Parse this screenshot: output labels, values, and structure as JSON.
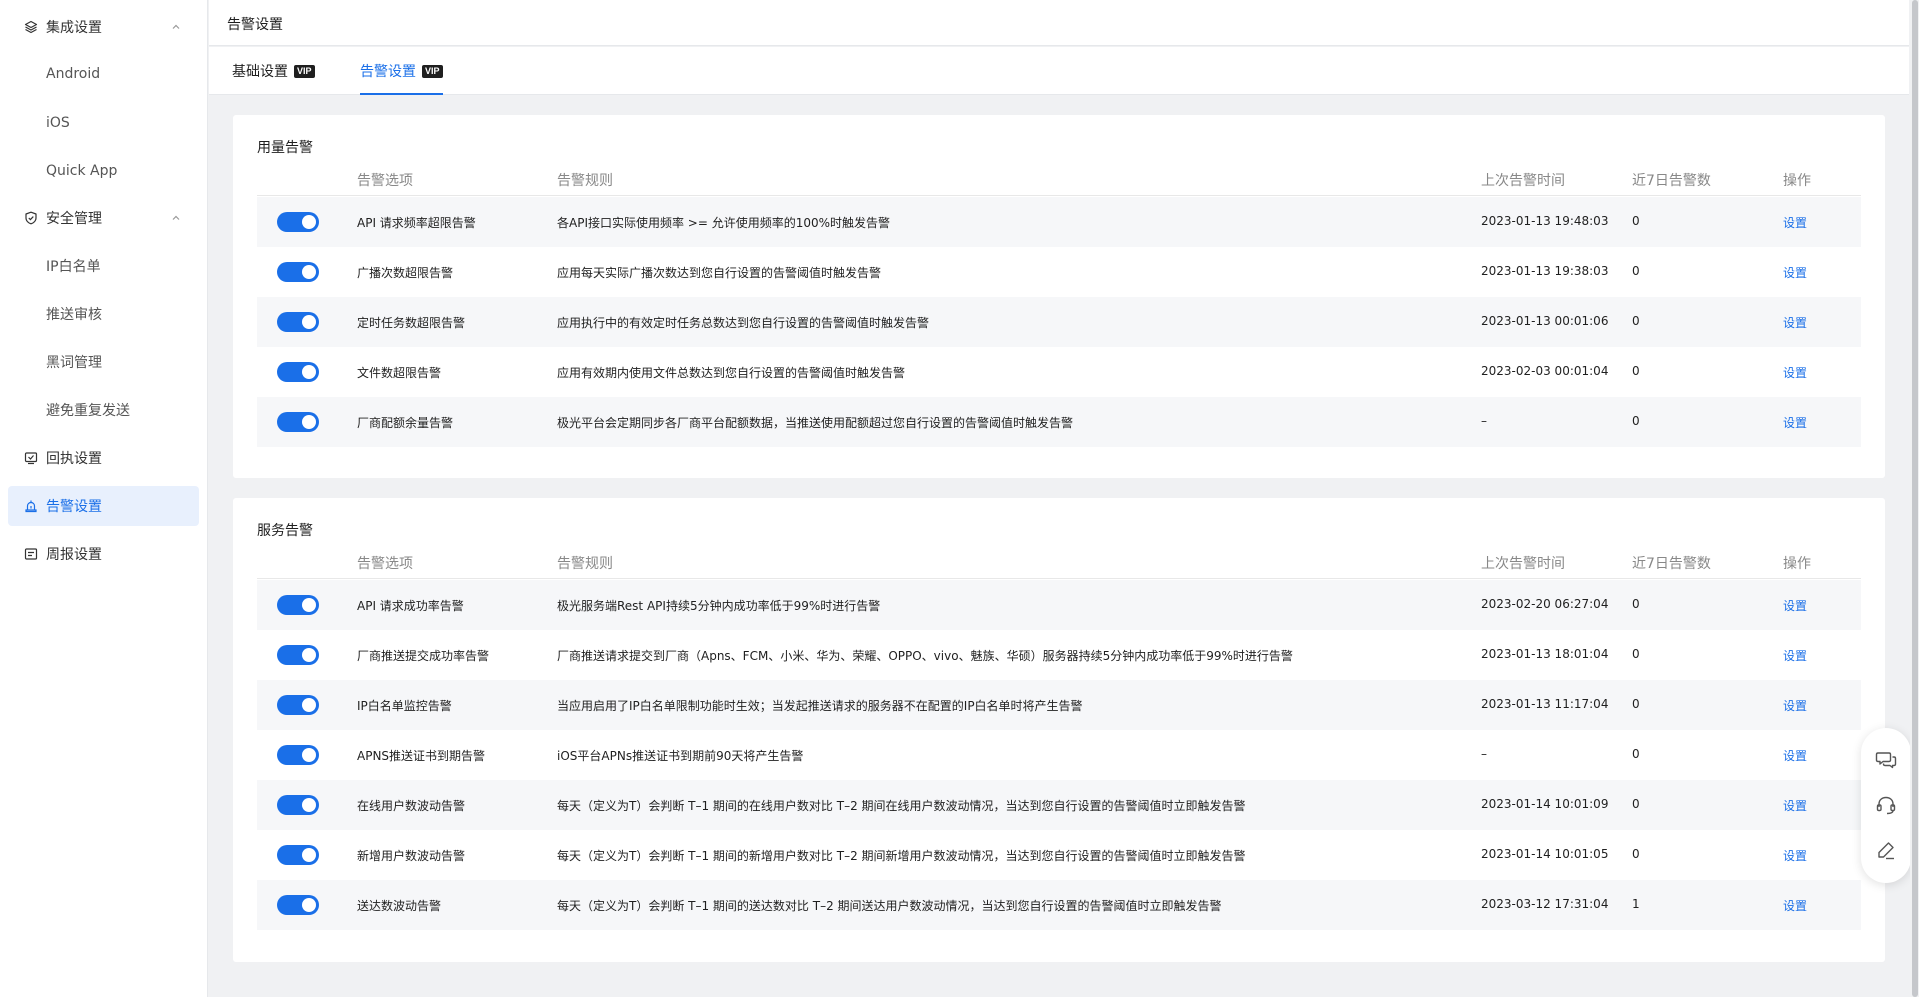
{
  "sidebar": {
    "groups": [
      {
        "label": "集成设置",
        "icon": "layers-icon",
        "children": [
          "Android",
          "iOS",
          "Quick App"
        ]
      },
      {
        "label": "安全管理",
        "icon": "shield-icon",
        "children": [
          "IP白名单",
          "推送审核",
          "黑词管理",
          "避免重复发送"
        ]
      }
    ],
    "items": [
      {
        "label": "回执设置",
        "icon": "receipt-icon"
      },
      {
        "label": "告警设置",
        "icon": "alarm-icon"
      },
      {
        "label": "周报设置",
        "icon": "report-icon"
      }
    ]
  },
  "header": {
    "title": "告警设置"
  },
  "tabs": [
    {
      "label": "基础设置",
      "badge": "VIP"
    },
    {
      "label": "告警设置",
      "badge": "VIP",
      "active": true
    }
  ],
  "columns": {
    "option": "告警选项",
    "rule": "告警规则",
    "last_time": "上次告警时间",
    "count7": "近7日告警数",
    "action": "操作"
  },
  "usage": {
    "title": "用量告警",
    "rows": [
      {
        "name": "API 请求频率超限告警",
        "rule": "各API接口实际使用频率 >= 允许使用频率的100%时触发告警",
        "time": "2023-01-13 19:48:03",
        "count": "0",
        "op": "设置",
        "enabled": true
      },
      {
        "name": "广播次数超限告警",
        "rule": "应用每天实际广播次数达到您自行设置的告警阈值时触发告警",
        "time": "2023-01-13 19:38:03",
        "count": "0",
        "op": "设置",
        "enabled": true
      },
      {
        "name": "定时任务数超限告警",
        "rule": "应用执行中的有效定时任务总数达到您自行设置的告警阈值时触发告警",
        "time": "2023-01-13 00:01:06",
        "count": "0",
        "op": "设置",
        "enabled": true
      },
      {
        "name": "文件数超限告警",
        "rule": "应用有效期内使用文件总数达到您自行设置的告警阈值时触发告警",
        "time": "2023-02-03 00:01:04",
        "count": "0",
        "op": "设置",
        "enabled": true
      },
      {
        "name": "厂商配额余量告警",
        "rule": "极光平台会定期同步各厂商平台配额数据，当推送使用配额超过您自行设置的告警阈值时触发告警",
        "time": "–",
        "count": "0",
        "op": "设置",
        "enabled": true
      }
    ]
  },
  "service": {
    "title": "服务告警",
    "rows": [
      {
        "name": "API 请求成功率告警",
        "rule": "极光服务端Rest API持续5分钟内成功率低于99%时进行告警",
        "time": "2023-02-20 06:27:04",
        "count": "0",
        "op": "设置",
        "enabled": true
      },
      {
        "name": "厂商推送提交成功率告警",
        "rule": "厂商推送请求提交到厂商（Apns、FCM、小米、华为、荣耀、OPPO、vivo、魅族、华硕）服务器持续5分钟内成功率低于99%时进行告警",
        "time": "2023-01-13 18:01:04",
        "count": "0",
        "op": "设置",
        "enabled": true
      },
      {
        "name": "IP白名单监控告警",
        "rule": "当应用启用了IP白名单限制功能时生效；当发起推送请求的服务器不在配置的IP白名单时将产生告警",
        "time": "2023-01-13 11:17:04",
        "count": "0",
        "op": "设置",
        "enabled": true
      },
      {
        "name": "APNS推送证书到期告警",
        "rule": "iOS平台APNs推送证书到期前90天将产生告警",
        "time": "–",
        "count": "0",
        "op": "设置",
        "enabled": true
      },
      {
        "name": "在线用户数波动告警",
        "rule": "每天（定义为T）会判断 T–1 期间的在线用户数对比 T–2 期间在线用户数波动情况，当达到您自行设置的告警阈值时立即触发告警",
        "time": "2023-01-14 10:01:09",
        "count": "0",
        "op": "设置",
        "enabled": true
      },
      {
        "name": "新增用户数波动告警",
        "rule": "每天（定义为T）会判断 T–1 期间的新增用户数对比 T–2 期间新增用户数波动情况，当达到您自行设置的告警阈值时立即触发告警",
        "time": "2023-01-14 10:01:05",
        "count": "0",
        "op": "设置",
        "enabled": true
      },
      {
        "name": "送达数波动告警",
        "rule": "每天（定义为T）会判断 T–1 期间的送达数对比 T–2 期间送达用户数波动情况，当达到您自行设置的告警阈值时立即触发告警",
        "time": "2023-03-12 17:31:04",
        "count": "1",
        "op": "设置",
        "enabled": true
      }
    ]
  },
  "float_toolbar": [
    "chat-icon",
    "headset-icon",
    "edit-icon"
  ],
  "colors": {
    "accent": "#1a6fe8",
    "page_bg": "#f0f1f3"
  }
}
